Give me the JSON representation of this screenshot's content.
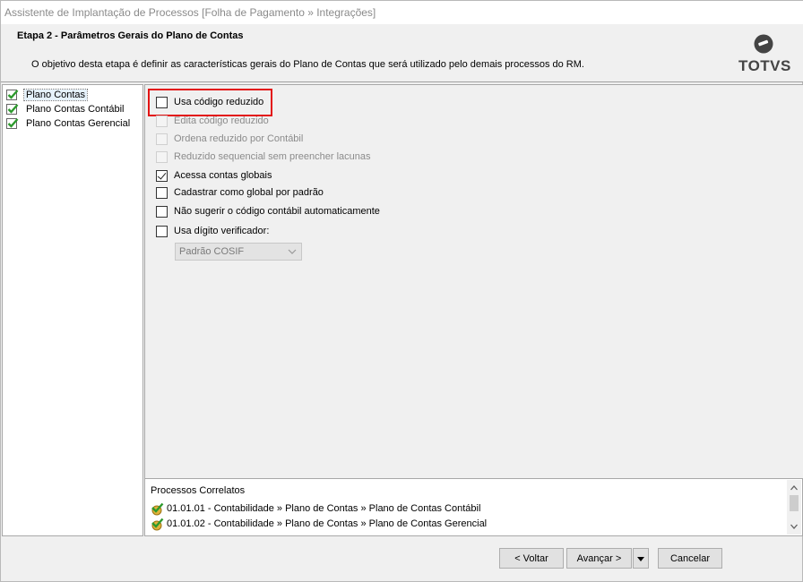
{
  "window": {
    "title": "Assistente de Implantação de Processos [Folha de Pagamento » Integrações]"
  },
  "header": {
    "step_title": "Etapa 2 - Parâmetros Gerais do Plano de Contas",
    "step_description": "O objetivo desta etapa é definir as características gerais do Plano de Contas que será utilizado pelo demais processos do RM.",
    "logo_text": "TOTVS"
  },
  "tree": {
    "items": [
      {
        "label": "Plano Contas",
        "selected": true
      },
      {
        "label": "Plano Contas Contábil",
        "selected": false
      },
      {
        "label": "Plano Contas Gerencial",
        "selected": false
      }
    ]
  },
  "options": {
    "items": [
      {
        "label": "Usa código reduzido",
        "checked": false,
        "enabled": true
      },
      {
        "label": "Edita código reduzido",
        "checked": false,
        "enabled": false
      },
      {
        "label": "Ordena reduzido por Contábil",
        "checked": false,
        "enabled": false
      },
      {
        "label": "Reduzido sequencial sem preencher lacunas",
        "checked": false,
        "enabled": false
      },
      {
        "label": "Acessa contas globais",
        "checked": true,
        "enabled": true
      },
      {
        "label": "Cadastrar como global por padrão",
        "checked": false,
        "enabled": true
      },
      {
        "label": "Não sugerir o código contábil automaticamente",
        "checked": false,
        "enabled": true
      },
      {
        "label": "Usa dígito verificador:",
        "checked": false,
        "enabled": true
      }
    ],
    "verifier_select": {
      "selected": "Padrão COSIF",
      "enabled": false
    }
  },
  "related": {
    "title": "Processos Correlatos",
    "items": [
      "01.01.01 - Contabilidade » Plano de Contas » Plano de Contas Contábil",
      "01.01.02 - Contabilidade » Plano de Contas » Plano de Contas Gerencial"
    ]
  },
  "footer": {
    "back_label": "< Voltar",
    "next_label": "Avançar >",
    "cancel_label": "Cancelar"
  },
  "colors": {
    "highlight": "#e31414",
    "check_green": "#2e9a2e"
  }
}
